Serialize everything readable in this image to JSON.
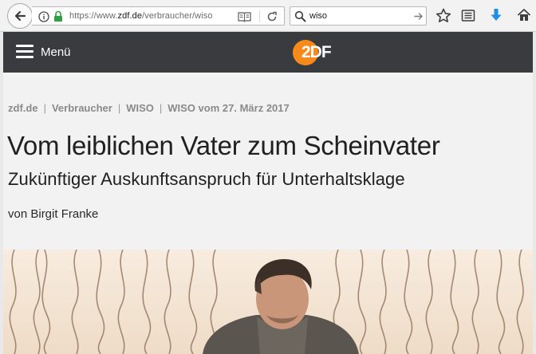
{
  "browser": {
    "url_prefix": "https://www.",
    "url_host": "zdf.de",
    "url_path": "/verbraucher/wiso",
    "search_value": "wiso"
  },
  "site": {
    "menu_label": "Menü",
    "logo_text": "2DF",
    "brand_color": "#f88a1b",
    "header_color": "#3a3b3e"
  },
  "article": {
    "breadcrumb": [
      "zdf.de",
      "Verbraucher",
      "WISO",
      "WISO vom 27. März 2017"
    ],
    "title": "Vom leiblichen Vater zum Scheinvater",
    "subtitle": "Zukünftiger Auskunftsanspruch für Unterhaltsklage",
    "author": "von Birgit Franke"
  },
  "icons": {
    "toolbar": [
      "back-icon",
      "info-icon",
      "lock-icon",
      "reader-view-icon",
      "reload-icon",
      "search-icon",
      "go-arrow-icon",
      "bookmark-star-icon",
      "library-icon",
      "download-icon",
      "home-icon"
    ]
  }
}
